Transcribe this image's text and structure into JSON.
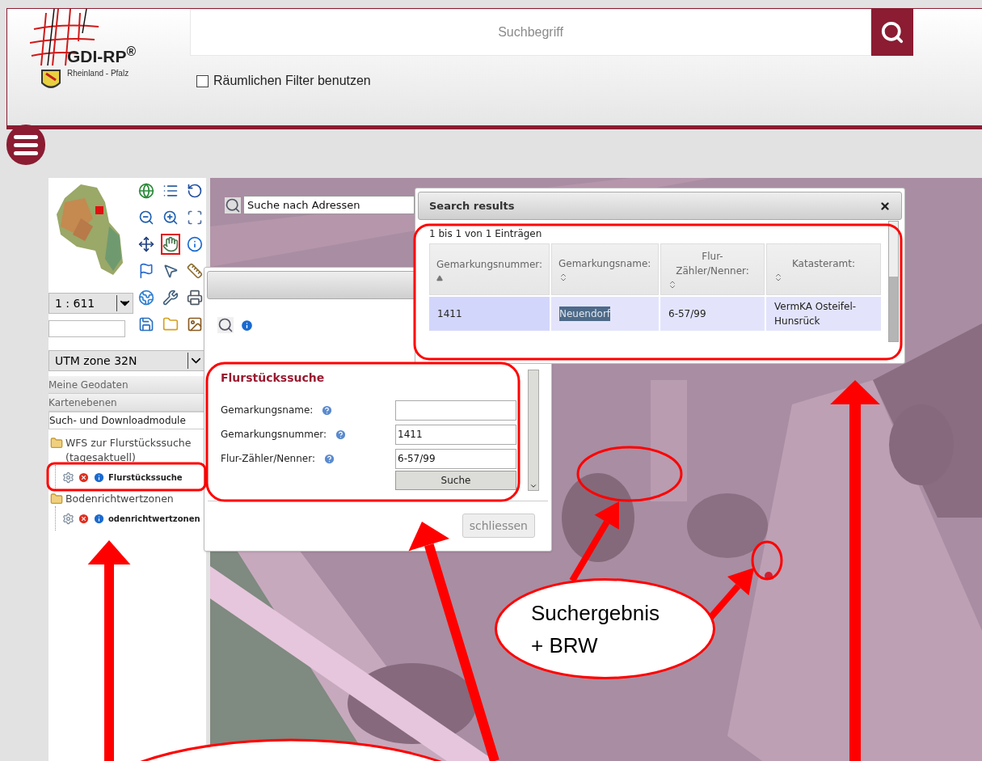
{
  "header": {
    "logo_title": "GDI-RP$^{®}$",
    "logo_subtitle": "Rheinland - Pfalz"
  },
  "search": {
    "placeholder": "Suchbegriff"
  },
  "spatial_filter": {
    "label": "Räumlichen Filter benutzen",
    "checked": false
  },
  "toolbar": {
    "tools": [
      {
        "selected": false
      },
      {
        "selected": false
      },
      {
        "selected": false
      },
      {
        "selected": false
      },
      {
        "selected": false
      },
      {
        "selected": false
      },
      {
        "selected": false
      },
      {
        "selected": true
      },
      {
        "selected": false
      },
      {
        "selected": false
      },
      {
        "selected": false
      },
      {
        "selected": false
      },
      {
        "selected": false
      },
      {
        "selected": false
      },
      {
        "selected": false
      },
      {
        "selected": false
      },
      {
        "selected": false
      },
      {
        "selected": false
      }
    ]
  },
  "scale": {
    "value": "1 : 611"
  },
  "projection": {
    "value": "UTM zone 32N"
  },
  "sidebar": {
    "sections": [
      {
        "label": "Meine Geodaten",
        "selected": false
      },
      {
        "label": "Kartenebenen",
        "selected": false
      },
      {
        "label": "Such- und Downloadmodule",
        "selected": true
      }
    ],
    "tree": [
      {
        "label": "WFS zur Flurstückssuche (tagesaktuell)",
        "children": [
          {
            "label": "Flurstückssuche"
          }
        ]
      },
      {
        "label": "Bodenrichtwertzonen",
        "children": [
          {
            "label": "odenrichtwertzonen"
          }
        ]
      }
    ]
  },
  "address_search": {
    "value": "Suche nach Adressen"
  },
  "parcel_dialog": {
    "title": "Flurstückssuche",
    "fields": [
      {
        "label": "Gemarkungsname:"
      },
      {
        "label": "Gemarkungsnummer:",
        "value": "1411"
      },
      {
        "label": "Flur-Zähler/Nenner:",
        "value": "6-57/99"
      }
    ],
    "submit": "Suche",
    "close": "schliessen"
  },
  "results": {
    "title": "Search results",
    "summary": "1 bis 1 von 1 Einträgen",
    "columns": [
      {
        "label": "Gemarkungsnummer:",
        "sorted": true
      },
      {
        "label": "Gemarkungsname:",
        "sorted": false
      },
      {
        "label": "Flur-Zähler/Nenner:",
        "sorted": false
      },
      {
        "label": "Katasteramt:",
        "sorted": false
      }
    ],
    "rows": [
      {
        "selected": true,
        "cells": [
          {
            "text": "1411",
            "highlighted": false
          },
          {
            "text": "Neuendorf",
            "highlighted": true
          },
          {
            "text": "6-57/99",
            "highlighted": false
          },
          {
            "text": "VermKA Osteifel-Hunsrück",
            "highlighted": false
          }
        ]
      }
    ]
  },
  "callout": {
    "lines": [
      "Suchergebnis",
      "+ BRW"
    ]
  }
}
